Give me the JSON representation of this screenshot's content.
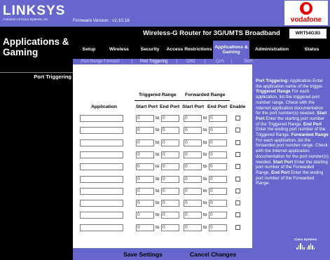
{
  "brand": {
    "logo": "LINKSYS",
    "logo_sub": "A Division of Cisco Systems, Inc.",
    "firmware": "Firmware Version : v2.10.16"
  },
  "partner": {
    "name": "vodafone"
  },
  "product": {
    "name": "Wireless-G Router for 3G/UMTS Broadband",
    "model": "WRT54G3G"
  },
  "page_title": "Applications & Gaming",
  "tabs": [
    {
      "label": "Setup"
    },
    {
      "label": "Wireless"
    },
    {
      "label": "Security"
    },
    {
      "label": "Access Restrictions"
    },
    {
      "label": "Applications & Gaming",
      "active": true
    },
    {
      "label": "Administration"
    },
    {
      "label": "Status"
    }
  ],
  "subtabs": [
    {
      "label": "Port Range Forward"
    },
    {
      "label": "Port Triggering",
      "active": true
    },
    {
      "label": "DMZ"
    },
    {
      "label": "QoS"
    },
    {
      "label": "SMS"
    }
  ],
  "section_title": "Port Triggering",
  "table": {
    "group_headers": {
      "triggered": "Triggered Range",
      "forwarded": "Forwarded Range"
    },
    "columns": {
      "application": "Application",
      "start_port": "Start Port",
      "end_port": "End Port",
      "enable": "Enable"
    },
    "to_label": "to",
    "rows": [
      {
        "application": "",
        "trig_start": "0",
        "trig_end": "0",
        "fwd_start": "0",
        "fwd_end": "0",
        "enabled": false
      },
      {
        "application": "",
        "trig_start": "0",
        "trig_end": "0",
        "fwd_start": "0",
        "fwd_end": "0",
        "enabled": false
      },
      {
        "application": "",
        "trig_start": "0",
        "trig_end": "0",
        "fwd_start": "0",
        "fwd_end": "0",
        "enabled": false
      },
      {
        "application": "",
        "trig_start": "0",
        "trig_end": "0",
        "fwd_start": "0",
        "fwd_end": "0",
        "enabled": false
      },
      {
        "application": "",
        "trig_start": "0",
        "trig_end": "0",
        "fwd_start": "0",
        "fwd_end": "0",
        "enabled": false
      },
      {
        "application": "",
        "trig_start": "0",
        "trig_end": "0",
        "fwd_start": "0",
        "fwd_end": "0",
        "enabled": false
      },
      {
        "application": "",
        "trig_start": "0",
        "trig_end": "0",
        "fwd_start": "0",
        "fwd_end": "0",
        "enabled": false
      },
      {
        "application": "",
        "trig_start": "0",
        "trig_end": "0",
        "fwd_start": "0",
        "fwd_end": "0",
        "enabled": false
      },
      {
        "application": "",
        "trig_start": "0",
        "trig_end": "0",
        "fwd_start": "0",
        "fwd_end": "0",
        "enabled": false
      },
      {
        "application": "",
        "trig_start": "0",
        "trig_end": "0",
        "fwd_start": "0",
        "fwd_end": "0",
        "enabled": false
      }
    ]
  },
  "help": {
    "title": "Port Triggering:",
    "t1": "Application Enter the application name of the trigger.",
    "h_triggered": "Triggered Range",
    "t2": "For each application, list the triggered port number range. Check with the Internet application documentation for the port number(s) needed.",
    "h_start": "Start Port",
    "t3": "Enter the starting port number of the Triggered Range.",
    "h_end": "End Port",
    "t4": "Enter the ending port number of the Triggered Range.",
    "h_forwarded": "Forwarded Range",
    "t5": "For each application, list the forwarded port number range. Check with the Internet application documentation for the port number(s) needed.",
    "h_start2": "Start Port",
    "t6": "Enter the starting port number of the Forwarded Range.",
    "h_end2": "End Port",
    "t7": "Enter the ending port number of the Forwarded Range."
  },
  "cisco": {
    "label": "Cisco Systems"
  },
  "buttons": {
    "save": "Save Settings",
    "cancel": "Cancel Changes"
  },
  "colors": {
    "accent": "#6666cc",
    "dark": "#000000"
  }
}
